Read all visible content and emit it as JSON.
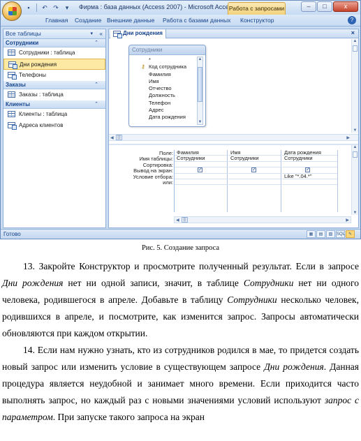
{
  "window": {
    "title": "Фирма : база данных (Access 2007) - Microsoft Acce...",
    "context_tab_group": "Работа с запросами",
    "controls": {
      "minimize": "–",
      "maximize": "□",
      "close": "x"
    }
  },
  "quick_access": {
    "save": "▪",
    "undo": "↶",
    "redo": "↷",
    "customize": "▾"
  },
  "ribbon": {
    "tabs": [
      "Главная",
      "Создание",
      "Внешние данные",
      "Работа с базами данных",
      "Конструктор"
    ],
    "help": "?"
  },
  "nav_pane": {
    "header": "Все таблицы",
    "dropdown": "▾",
    "collapse": "«",
    "groups": [
      {
        "label": "Сотрудники",
        "chevron": "⌃",
        "items": [
          {
            "label": "Сотрудники : таблица",
            "icon": "table-icon"
          },
          {
            "label": "Дни рождения",
            "icon": "query-icon",
            "selected": true
          },
          {
            "label": "Телефоны",
            "icon": "query-icon"
          }
        ]
      },
      {
        "label": "Заказы",
        "chevron": "⌃",
        "items": [
          {
            "label": "Заказы : таблица",
            "icon": "table-icon"
          }
        ]
      },
      {
        "label": "Клиенты",
        "chevron": "⌃",
        "items": [
          {
            "label": "Клиенты : таблица",
            "icon": "table-icon"
          },
          {
            "label": "Адреса клиентов",
            "icon": "query-icon"
          }
        ]
      }
    ]
  },
  "document": {
    "tab_label": "Дни рождения",
    "close": "×",
    "field_list": {
      "title": "Сотрудники",
      "fields": [
        "*",
        "Код сотрудника",
        "Фамилия",
        "Имя",
        "Отчество",
        "Должность",
        "Телефон",
        "Адрес",
        "Дата рождения"
      ],
      "key_field_index": 1
    },
    "qbe": {
      "row_labels": [
        "Поле:",
        "Имя таблицы:",
        "Сортировка:",
        "Вывод на экран:",
        "Условие отбора:",
        "или:"
      ],
      "columns": [
        {
          "field": "Фамилия",
          "table": "Сотрудники",
          "show": true,
          "criteria": ""
        },
        {
          "field": "Имя",
          "table": "Сотрудники",
          "show": true,
          "criteria": ""
        },
        {
          "field": "Дата рождения",
          "table": "Сотрудники",
          "show": true,
          "criteria": "Like \"*.04.*\""
        }
      ],
      "check_mark": "✓"
    }
  },
  "statusbar": {
    "text": "Готово",
    "views": [
      "▦",
      "▤",
      "▧",
      "SQL",
      "✎"
    ]
  },
  "caption": "Рис. 5. Создание запроса",
  "paragraphs": [
    [
      {
        "t": "13. Закройте Конструктор и просмотрите полученный результат. Если в запросе "
      },
      {
        "t": "Дни рождения",
        "i": true
      },
      {
        "t": " нет ни одной записи, значит, в таблице "
      },
      {
        "t": "Сотрудники",
        "i": true
      },
      {
        "t": " нет ни одного человека, родившегося в апреле. Добавьте в таблицу "
      },
      {
        "t": "Сотрудники",
        "i": true
      },
      {
        "t": " несколько человек, родившихся в апреле, и посмотрите, как изменится запрос. Запросы автоматически обновляются при каждом открытии."
      }
    ],
    [
      {
        "t": "14. Если нам нужно узнать, кто из сотрудников родился в мае, то придется создать новый запрос или изменить условие в существующем запросе "
      },
      {
        "t": "Дни рождения",
        "i": true
      },
      {
        "t": ". Данная процедура является неудобной и занимает много времени. Если приходится часто выполнять запрос, но каждый раз с новыми значениями условий используют "
      },
      {
        "t": "запрос с параметром",
        "i": true
      },
      {
        "t": ". При запуске такого запроса на экран"
      }
    ]
  ]
}
